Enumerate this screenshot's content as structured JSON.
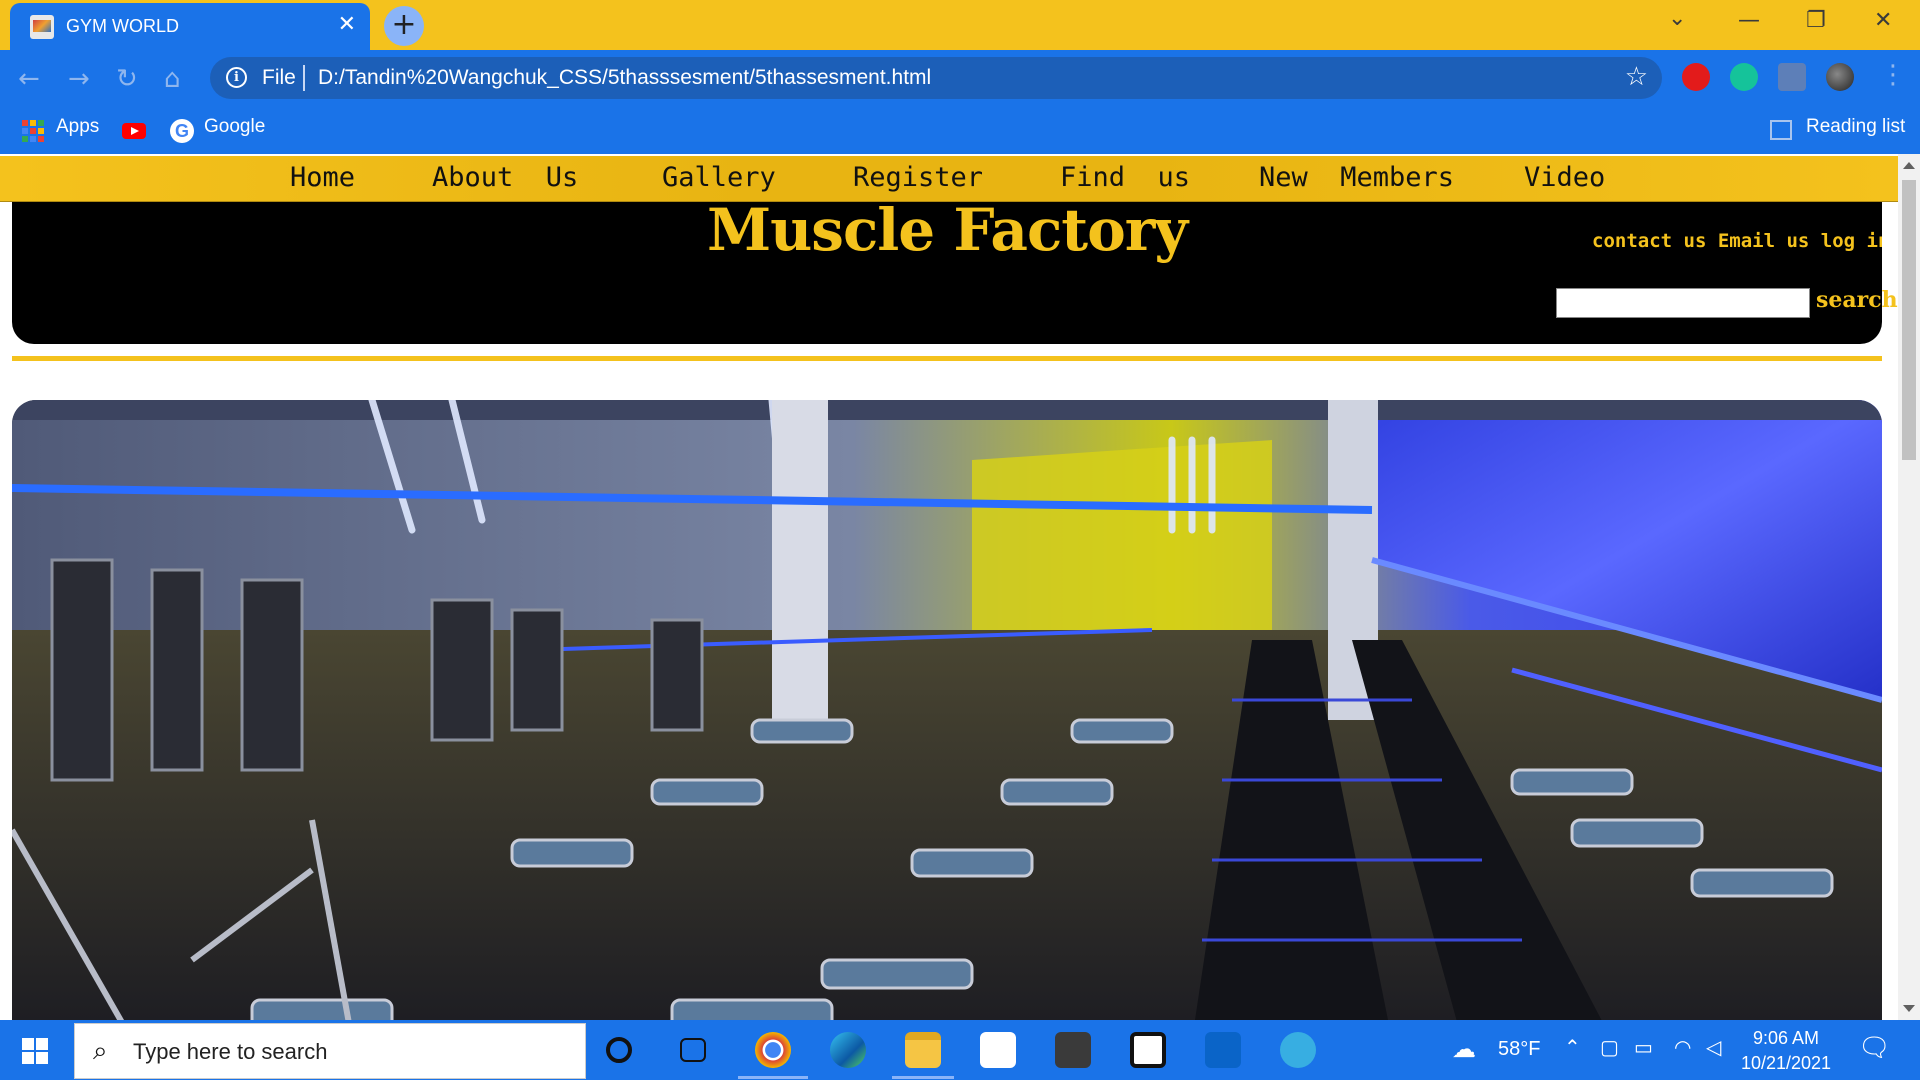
{
  "browser": {
    "tab_title": "GYM WORLD",
    "tab_close": "✕",
    "new_tab": "+",
    "address_label": "File",
    "url": "D:/Tandin%20Wangchuk_CSS/5thasssesment/5thassesment.html",
    "bookmarks": [
      {
        "label": "Apps",
        "icon": "apps-grid-icon"
      },
      {
        "label": "",
        "icon": "youtube-icon"
      },
      {
        "label": "Google",
        "icon": "google-icon"
      }
    ],
    "reading_list": "Reading list"
  },
  "page": {
    "nav": [
      "Home",
      "About  Us",
      "Gallery",
      "Register",
      "Find  us",
      "New  Members",
      "Video"
    ],
    "brand": "Muscle Factory",
    "header_links": "contact us Email us log in",
    "search_button": "search",
    "search_value": "",
    "hero_image": "gym-interior-photo"
  },
  "taskbar": {
    "search_placeholder": "Type here to search",
    "weather": "58°F",
    "time": "9:06 AM",
    "date": "10/21/2021"
  },
  "colors": {
    "accent_yellow": "#f4c21d",
    "browser_blue": "#1a73e8",
    "banner_black": "#000000"
  }
}
